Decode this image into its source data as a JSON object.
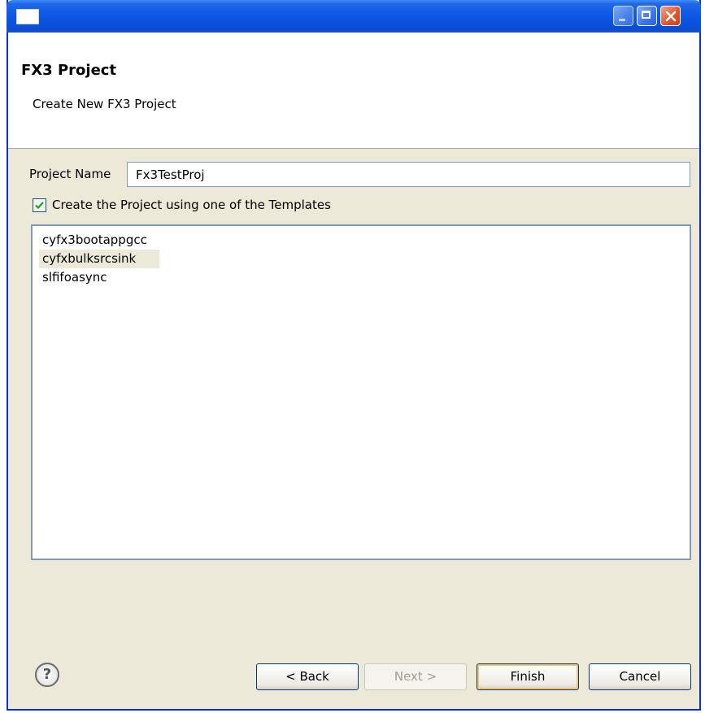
{
  "window": {
    "title": ""
  },
  "banner": {
    "title": "FX3 Project",
    "subtitle": "Create New FX3 Project"
  },
  "form": {
    "project_name_label": "Project Name",
    "project_name_value": "Fx3TestProj",
    "template_checkbox_label": "Create the Project using one of the Templates",
    "template_checkbox_checked": true
  },
  "templates": {
    "items": [
      "cyfx3bootappgcc",
      "cyfxbulksrcsink",
      "slfifoasync"
    ],
    "selected_index": 1
  },
  "buttons": {
    "help": "?",
    "back": "< Back",
    "next": "Next >",
    "finish": "Finish",
    "cancel": "Cancel"
  },
  "colors": {
    "titlebar": "#0a4fd6",
    "window_bg": "#ece9d8",
    "finish_focus": "#f7c36a"
  }
}
